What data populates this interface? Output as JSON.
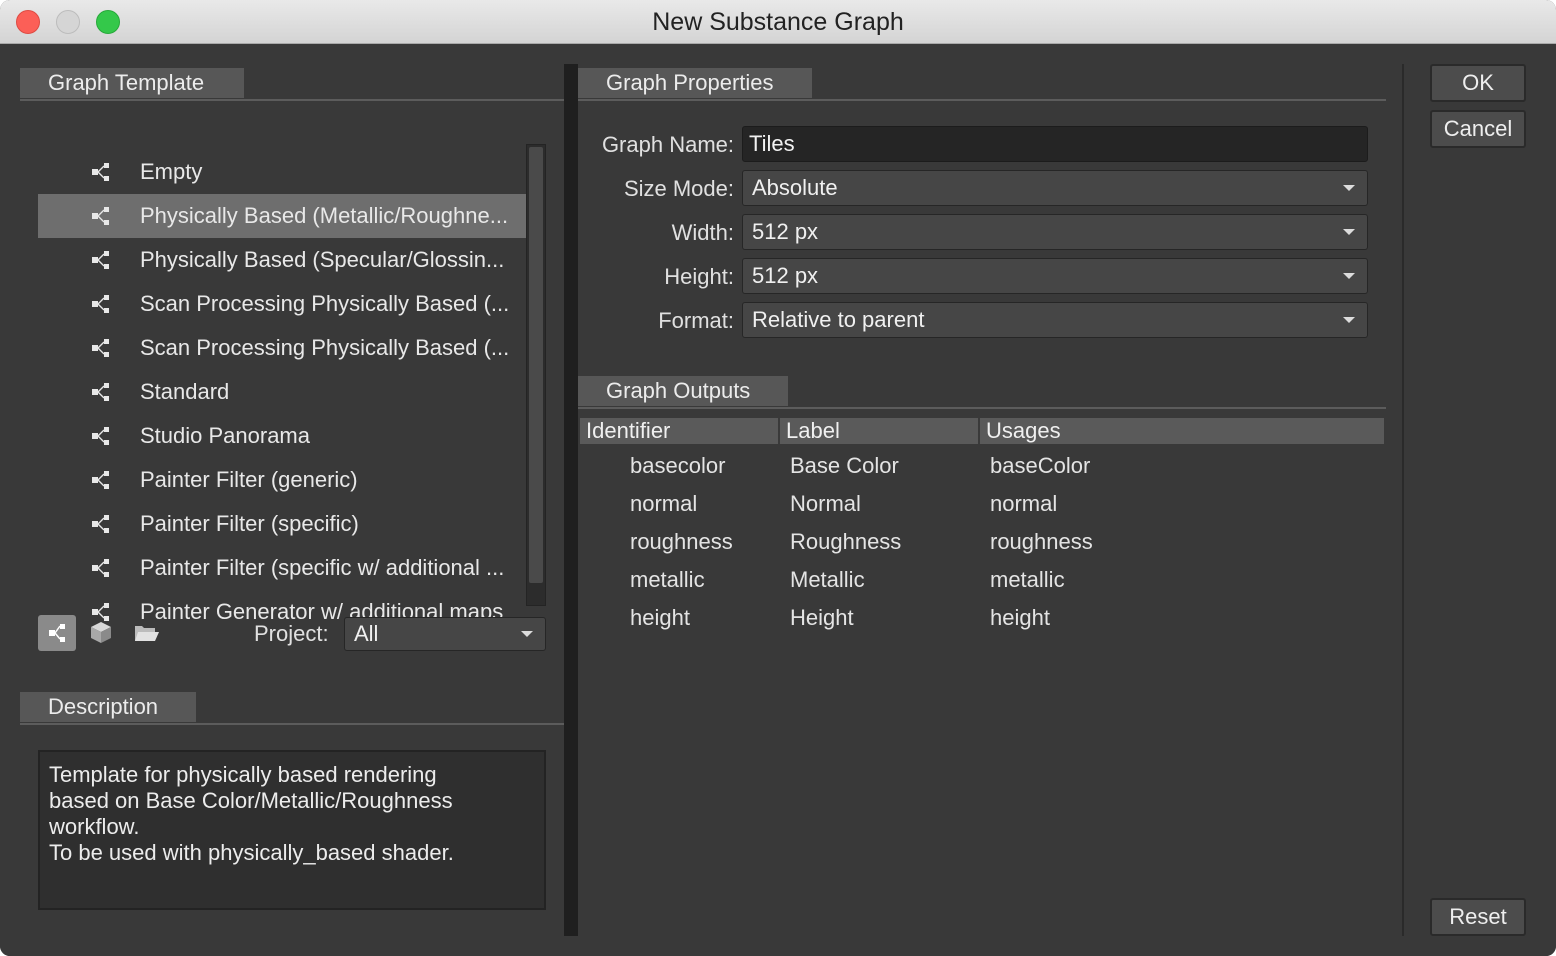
{
  "window": {
    "title": "New Substance Graph"
  },
  "graph_template": {
    "section_label": "Graph Template",
    "items": [
      {
        "label": "Empty",
        "icon": "graph-node-icon",
        "selected": false
      },
      {
        "label": "Physically Based (Metallic/Roughne...",
        "icon": "graph-node-icon",
        "selected": true
      },
      {
        "label": "Physically Based (Specular/Glossin...",
        "icon": "graph-node-icon",
        "selected": false
      },
      {
        "label": "Scan Processing Physically Based (...",
        "icon": "graph-node-icon",
        "selected": false
      },
      {
        "label": "Scan Processing Physically Based (...",
        "icon": "graph-node-icon",
        "selected": false
      },
      {
        "label": "Standard",
        "icon": "graph-node-icon",
        "selected": false
      },
      {
        "label": "Studio Panorama",
        "icon": "graph-node-icon",
        "selected": false
      },
      {
        "label": "Painter Filter (generic)",
        "icon": "graph-node-icon",
        "selected": false
      },
      {
        "label": "Painter Filter (specific)",
        "icon": "graph-node-icon",
        "selected": false
      },
      {
        "label": "Painter Filter (specific w/ additional ...",
        "icon": "graph-node-icon",
        "selected": false
      },
      {
        "label": "Painter Generator w/ additional maps",
        "icon": "graph-node-icon",
        "selected": false
      }
    ],
    "project_label": "Project:",
    "project_value": "All"
  },
  "description": {
    "section_label": "Description",
    "text": "Template for physically based rendering\nbased on Base Color/Metallic/Roughness\nworkflow.\nTo be used with physically_based shader."
  },
  "graph_properties": {
    "section_label": "Graph Properties",
    "name_label": "Graph Name:",
    "name_value": "Tiles",
    "size_mode_label": "Size Mode:",
    "size_mode_value": "Absolute",
    "width_label": "Width:",
    "width_value": "512 px",
    "height_label": "Height:",
    "height_value": "512 px",
    "format_label": "Format:",
    "format_value": "Relative to parent"
  },
  "graph_outputs": {
    "section_label": "Graph Outputs",
    "columns": [
      "Identifier",
      "Label",
      "Usages"
    ],
    "rows": [
      [
        "basecolor",
        "Base Color",
        "baseColor"
      ],
      [
        "normal",
        "Normal",
        "normal"
      ],
      [
        "roughness",
        "Roughness",
        "roughness"
      ],
      [
        "metallic",
        "Metallic",
        "metallic"
      ],
      [
        "height",
        "Height",
        "height"
      ]
    ]
  },
  "buttons": {
    "ok": "OK",
    "cancel": "Cancel",
    "reset": "Reset"
  },
  "colors": {
    "selected_row": "#6e6e6e",
    "panel_bg": "#393939",
    "close": "#fc5f57",
    "maximize": "#34c84a"
  }
}
